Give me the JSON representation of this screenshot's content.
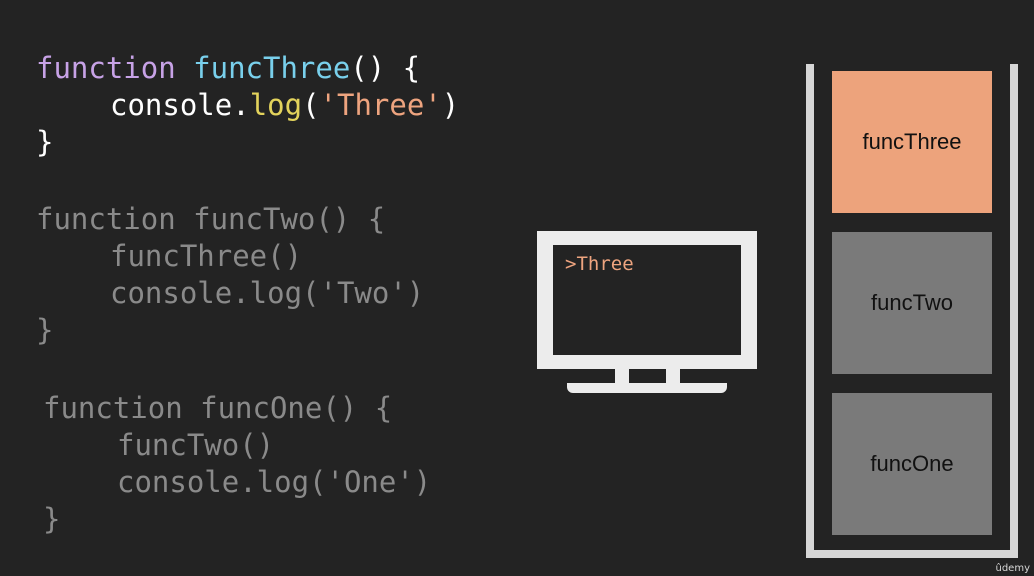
{
  "code_blocks": [
    {
      "line1": {
        "keyword": "function",
        "name": "funcThree",
        "rest": "() {"
      },
      "line2": {
        "object": "console.",
        "method": "log",
        "open": "(",
        "string": "'Three'",
        "close": ")"
      },
      "line3": "}"
    },
    {
      "line1": "function funcTwo() {",
      "line2": "funcThree()",
      "line3": "console.log('Two')",
      "line4": "}"
    },
    {
      "line1": "function funcOne() {",
      "line2": "funcTwo()",
      "line3": "console.log('One')",
      "line4": "}"
    }
  ],
  "console": {
    "output": ">Three"
  },
  "call_stack": {
    "frames": [
      {
        "label": "funcThree",
        "color": "#eda37c"
      },
      {
        "label": "funcTwo",
        "color": "#7a7a7a"
      },
      {
        "label": "funcOne",
        "color": "#7a7a7a"
      }
    ]
  },
  "watermark": "ûdemy",
  "colors": {
    "background": "#232323",
    "keyword": "#c7a2e6",
    "function_name": "#79d0ec",
    "method": "#e3d35c",
    "string": "#eea47f",
    "dimmed_code": "#8a8a8a",
    "monitor": "#ececec"
  }
}
